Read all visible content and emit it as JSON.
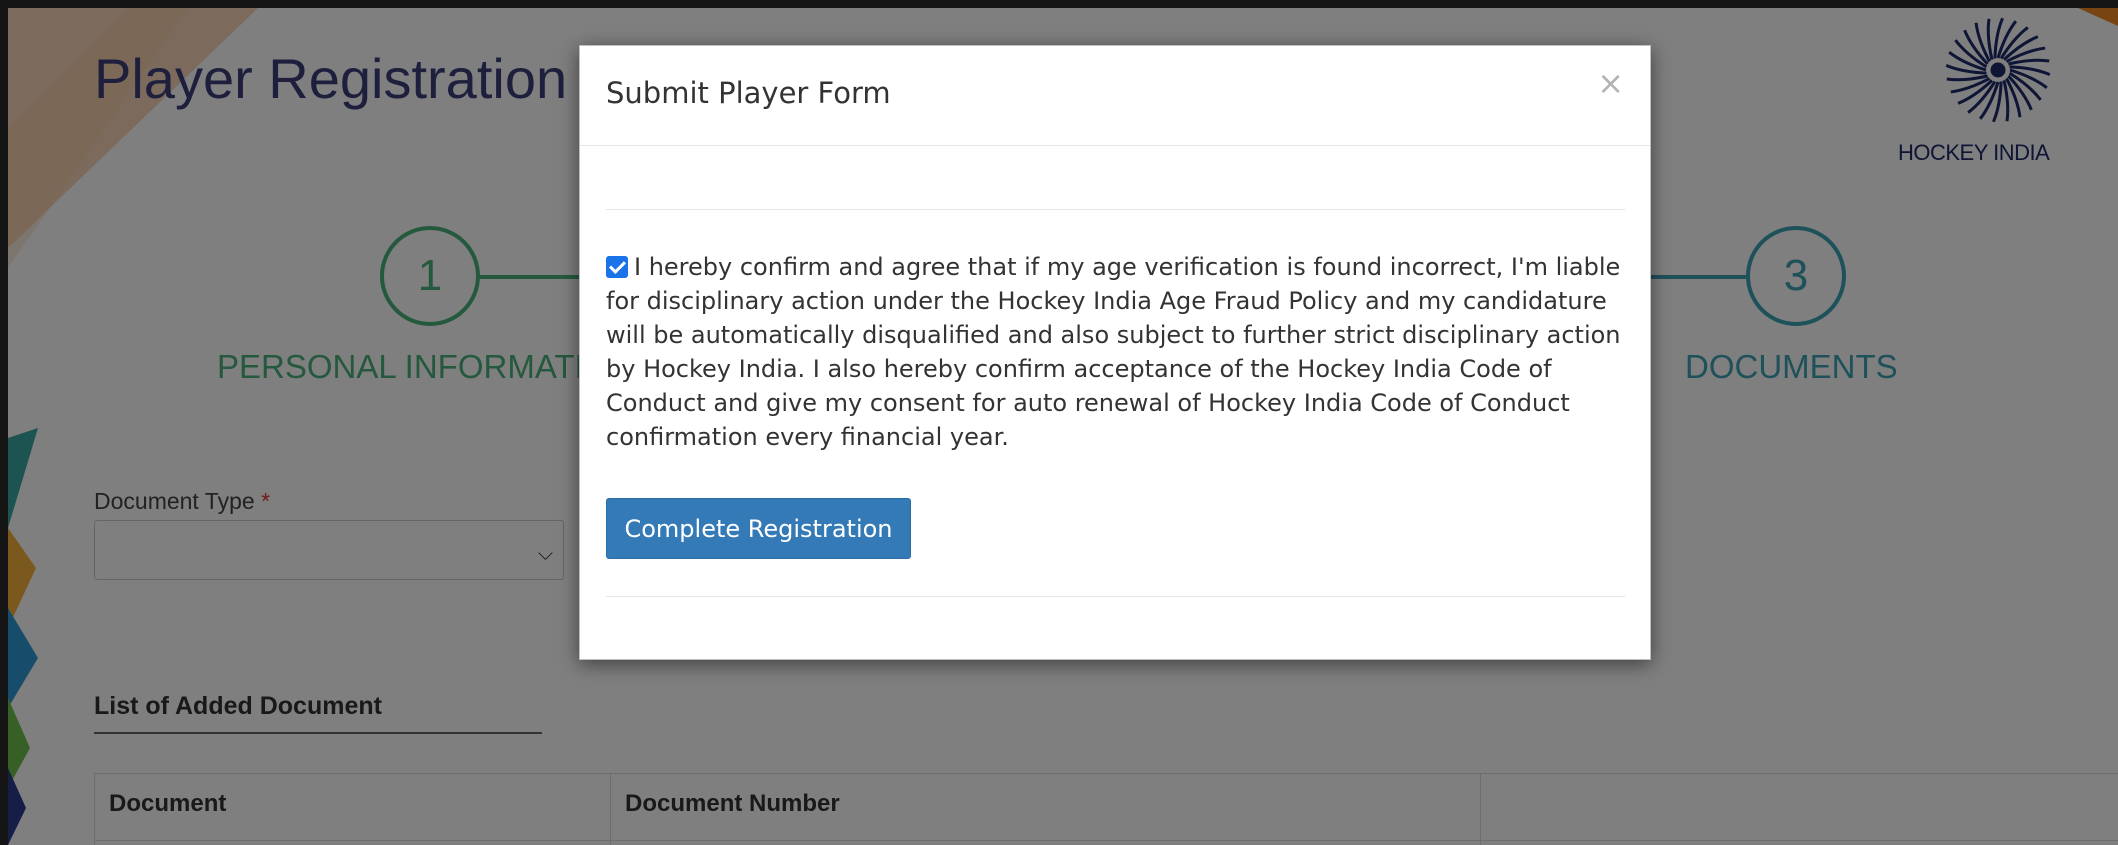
{
  "page": {
    "title": "Player Registration Form",
    "brand": {
      "logo_text": "HOCKEY INDIA",
      "icon": "hockey-india-emblem-icon"
    }
  },
  "steps": [
    {
      "number": "1",
      "label": "PERSONAL INFORMATION",
      "color": "#4bb27a"
    },
    {
      "number": "3",
      "label": "DOCUMENTS",
      "color": "#3da2b5"
    }
  ],
  "document_form": {
    "type_label": "Document Type",
    "required_mark": "*",
    "selected_value": ""
  },
  "document_list": {
    "title": "List of Added Document",
    "columns": [
      "Document",
      "Document Number",
      ""
    ]
  },
  "modal": {
    "title": "Submit Player Form",
    "close_label": "×",
    "confirm_checked": true,
    "confirm_text": "I hereby confirm and agree that if my age verification is found incorrect, I'm liable for disciplinary action under the Hockey India Age Fraud Policy and my candidature will be automatically disqualified and also subject to further strict disciplinary action by Hockey India. I also hereby confirm acceptance of the Hockey India Code of Conduct and give my consent for auto renewal of Hockey India Code of Conduct confirmation every financial year.",
    "button_label": "Complete Registration",
    "button_color": "#337ab7"
  }
}
